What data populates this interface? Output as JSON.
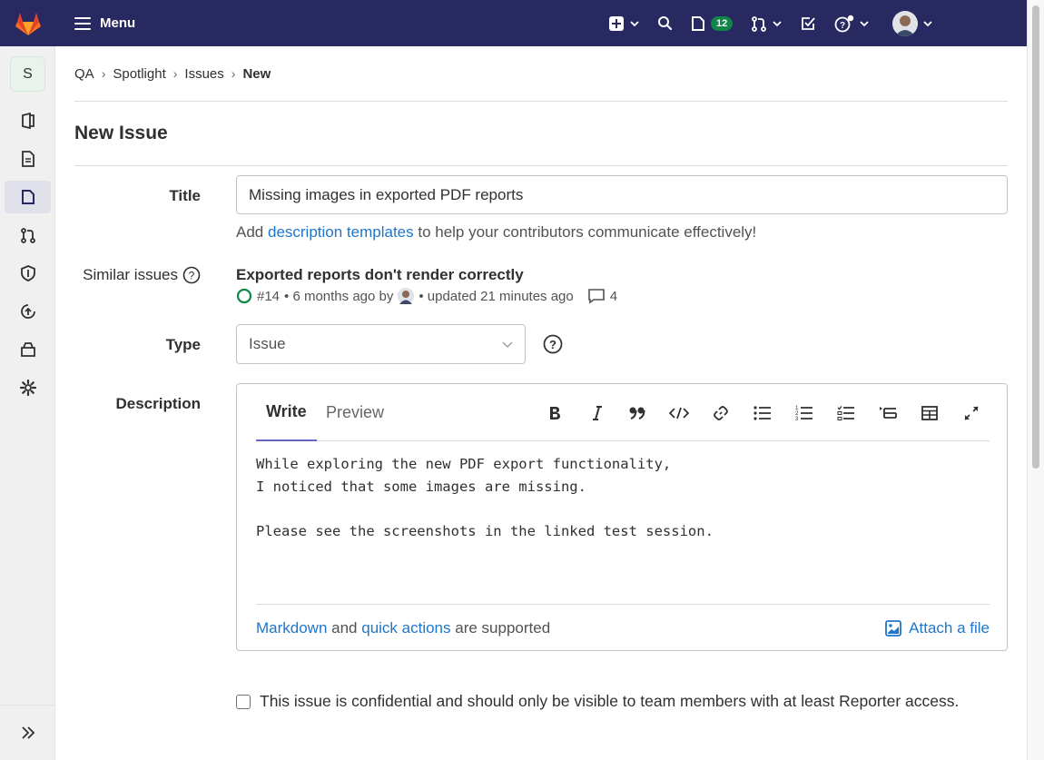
{
  "nav": {
    "menu_label": "Menu",
    "issues_count": "12"
  },
  "sidebar": {
    "project_letter": "S"
  },
  "breadcrumb": [
    "QA",
    "Spotlight",
    "Issues",
    "New"
  ],
  "page": {
    "title": "New Issue"
  },
  "form": {
    "title_label": "Title",
    "title_value": "Missing images in exported PDF reports",
    "hint_prefix": "Add ",
    "hint_link": "description templates",
    "hint_suffix": " to help your contributors communicate effectively!",
    "similar_label": "Similar issues",
    "similar_issue": {
      "title": "Exported reports don't render correctly",
      "number": "#14",
      "created": "• 6 months ago by",
      "updated": "• updated 21 minutes ago",
      "comments": "4"
    },
    "type_label": "Type",
    "type_value": "Issue",
    "description_label": "Description",
    "editor": {
      "tab_write": "Write",
      "tab_preview": "Preview",
      "content": "While exploring the new PDF export functionality,\nI noticed that some images are missing.\n\nPlease see the screenshots in the linked test session.",
      "footer_link1": "Markdown",
      "footer_and": " and ",
      "footer_link2": "quick actions",
      "footer_suffix": " are supported",
      "attach_label": "Attach a file"
    },
    "confidential_label": "This issue is confidential and should only be visible to team members with at least Reporter access."
  },
  "colors": {
    "nav_bg": "#292961",
    "link": "#1f75cb",
    "success": "#108548",
    "tab_active": "#6666c4"
  }
}
